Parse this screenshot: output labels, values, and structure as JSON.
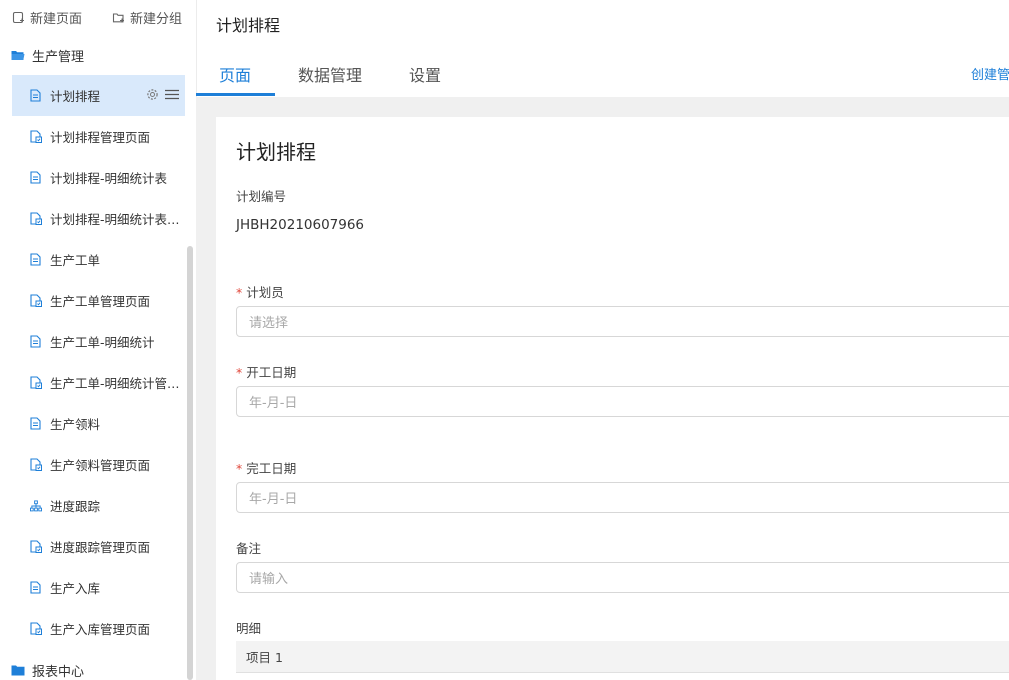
{
  "sidebar": {
    "actions": [
      {
        "label": "新建页面",
        "icon": "new-page-icon"
      },
      {
        "label": "新建分组",
        "icon": "new-group-icon"
      }
    ],
    "groups": [
      {
        "label": "生产管理",
        "icon": "folder-open-icon"
      },
      {
        "label": "报表中心",
        "icon": "folder-icon"
      }
    ],
    "items": [
      {
        "label": "计划排程",
        "icon": "page-icon",
        "active": true
      },
      {
        "label": "计划排程管理页面",
        "icon": "manage-page-icon"
      },
      {
        "label": "计划排程-明细统计表",
        "icon": "page-icon"
      },
      {
        "label": "计划排程-明细统计表管理页面",
        "icon": "manage-page-icon"
      },
      {
        "label": "生产工单",
        "icon": "page-icon"
      },
      {
        "label": "生产工单管理页面",
        "icon": "manage-page-icon"
      },
      {
        "label": "生产工单-明细统计",
        "icon": "page-icon"
      },
      {
        "label": "生产工单-明细统计管理页面",
        "icon": "manage-page-icon"
      },
      {
        "label": "生产领料",
        "icon": "page-icon"
      },
      {
        "label": "生产领料管理页面",
        "icon": "manage-page-icon"
      },
      {
        "label": "进度跟踪",
        "icon": "org-chart-icon"
      },
      {
        "label": "进度跟踪管理页面",
        "icon": "manage-page-icon"
      },
      {
        "label": "生产入库",
        "icon": "page-icon"
      },
      {
        "label": "生产入库管理页面",
        "icon": "manage-page-icon"
      }
    ]
  },
  "header": {
    "title": "计划排程",
    "tabs": [
      {
        "label": "页面",
        "active": true
      },
      {
        "label": "数据管理"
      },
      {
        "label": "设置"
      }
    ],
    "create_link": "创建管"
  },
  "form": {
    "title": "计划排程",
    "plan_no_label": "计划编号",
    "plan_no_value": "JHBH20210607966",
    "planner_label": "计划员",
    "planner_placeholder": "请选择",
    "start_label": "开工日期",
    "start_placeholder": "年-月-日",
    "end_label": "完工日期",
    "end_placeholder": "年-月-日",
    "remark_label": "备注",
    "remark_placeholder": "请输入",
    "detail_label": "明细",
    "detail_columns": [
      "项目 1"
    ],
    "required_mark": "*"
  },
  "colors": {
    "accent": "#1e7fd8",
    "active_item_bg": "#d9e9fb",
    "required": "#e0463a"
  }
}
